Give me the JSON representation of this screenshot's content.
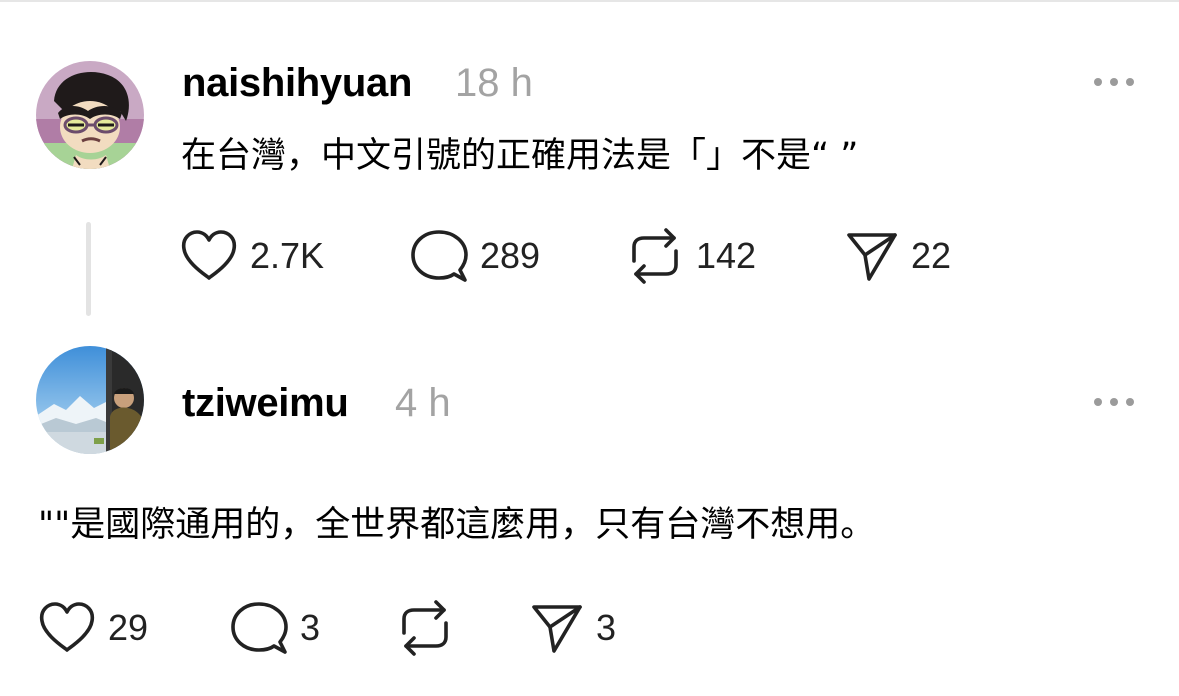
{
  "posts": [
    {
      "username": "naishihyuan",
      "time": "18 h",
      "text": "在台灣，中文引號的正確用法是「」不是“ ”",
      "likes": "2.7K",
      "replies": "289",
      "reposts": "142",
      "shares": "22"
    },
    {
      "username": "tziweimu",
      "time": "4 h",
      "text": "\"\"是國際通用的，全世界都這麼用，只有台灣不想用。",
      "likes": "29",
      "replies": "3",
      "reposts": "",
      "shares": "3"
    }
  ],
  "icons": {
    "like": "heart-icon",
    "reply": "comment-bubble-icon",
    "repost": "repost-icon",
    "share": "send-icon",
    "more": "more-horizontal-icon"
  },
  "colors": {
    "text": "#000000",
    "secondary": "#a3a3a3",
    "thread_line": "#e3e3e3"
  }
}
